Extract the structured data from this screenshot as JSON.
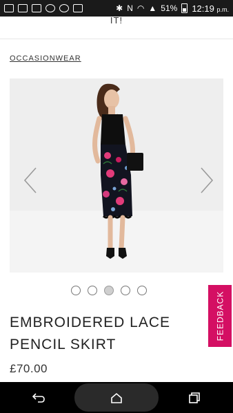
{
  "status_bar": {
    "battery": "51%",
    "time": "12:19",
    "ampm": "p.m."
  },
  "header": {
    "cut_text": "IT!"
  },
  "breadcrumb": {
    "label": "OCCASIONWEAR"
  },
  "gallery": {
    "total_images": 5,
    "active_index": 2
  },
  "feedback": {
    "label": "FEEDBACK"
  },
  "product": {
    "title": "EMBROIDERED LACE PENCIL SKIRT",
    "price": "£70.00"
  },
  "colors": {
    "feedback_bg": "#d40f63",
    "skirt_floral": "#e23b7a"
  },
  "nav": {
    "back_icon": "back-icon",
    "home_icon": "home-icon",
    "recents_icon": "recents-icon"
  }
}
